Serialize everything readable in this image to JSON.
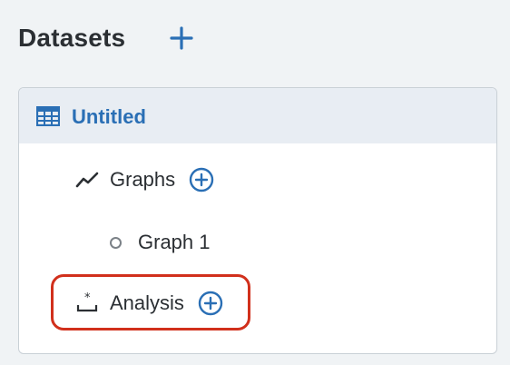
{
  "header": {
    "title": "Datasets",
    "add_icon": "plus-icon"
  },
  "dataset": {
    "name": "Untitled",
    "icon": "table-icon",
    "accent": "#2a6fb5",
    "children": {
      "graphs": {
        "label": "Graphs",
        "icon": "line-chart-icon",
        "items": [
          {
            "label": "Graph 1",
            "icon": "circle-bullet-icon"
          }
        ]
      },
      "analysis": {
        "label": "Analysis",
        "icon": "analysis-icon"
      }
    }
  },
  "colors": {
    "accent": "#2a6fb5",
    "selected_row_bg": "#e8edf3",
    "highlight": "#d1301c"
  }
}
